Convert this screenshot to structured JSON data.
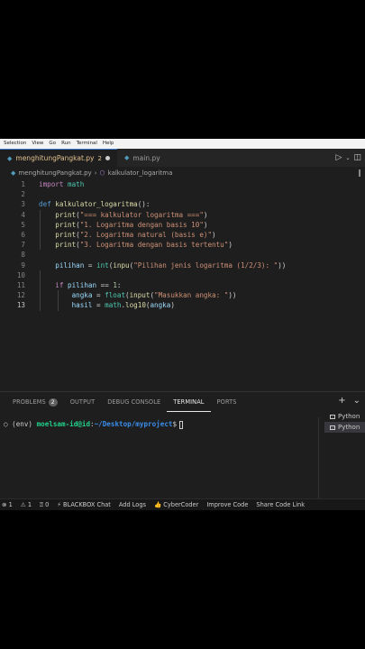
{
  "menubar": {
    "items": [
      "Selection",
      "View",
      "Go",
      "Run",
      "Terminal",
      "Help"
    ]
  },
  "tabs": [
    {
      "label": "menghitungPangkat.py",
      "badge": "2",
      "active": true
    },
    {
      "label": "main.py",
      "active": false
    }
  ],
  "tabbar_icons": {
    "run": "play-icon",
    "dropdown": "chevron-down-icon",
    "split": "split-editor-icon"
  },
  "breadcrumb": {
    "file": "menghitungPangkat.py",
    "separator": "›",
    "symbol": "kalkulator_logaritma"
  },
  "editor": {
    "lines": [
      {
        "n": "1",
        "tokens": [
          [
            "kw",
            "import"
          ],
          [
            "op",
            " "
          ],
          [
            "cls",
            "math"
          ]
        ]
      },
      {
        "n": "2",
        "tokens": []
      },
      {
        "n": "3",
        "tokens": [
          [
            "def",
            "def"
          ],
          [
            "op",
            " "
          ],
          [
            "fn",
            "kalkulator_logaritma"
          ],
          [
            "op",
            "():"
          ]
        ]
      },
      {
        "n": "4",
        "tokens": [
          [
            "op",
            "    "
          ],
          [
            "fn",
            "print"
          ],
          [
            "op",
            "("
          ],
          [
            "str",
            "\"=== kalkulator logaritma ===\""
          ],
          [
            "op",
            ")"
          ]
        ]
      },
      {
        "n": "5",
        "tokens": [
          [
            "op",
            "    "
          ],
          [
            "fn",
            "print"
          ],
          [
            "op",
            "("
          ],
          [
            "str",
            "\"1. Logaritma dengan basis 10\""
          ],
          [
            "op",
            ")"
          ]
        ]
      },
      {
        "n": "6",
        "tokens": [
          [
            "op",
            "    "
          ],
          [
            "fn",
            "print"
          ],
          [
            "op",
            "("
          ],
          [
            "str",
            "\"2. Logaritma natural (basis e)\""
          ],
          [
            "op",
            ")"
          ]
        ]
      },
      {
        "n": "7",
        "tokens": [
          [
            "op",
            "    "
          ],
          [
            "fn",
            "print"
          ],
          [
            "op",
            "("
          ],
          [
            "str",
            "\"3. Logaritma dengan basis tertentu\""
          ],
          [
            "op",
            ")"
          ]
        ]
      },
      {
        "n": "8",
        "tokens": []
      },
      {
        "n": "9",
        "tokens": [
          [
            "op",
            "    "
          ],
          [
            "var",
            "pilihan"
          ],
          [
            "op",
            " = "
          ],
          [
            "cls",
            "int"
          ],
          [
            "op",
            "("
          ],
          [
            "fn",
            "inpu"
          ],
          [
            "op",
            "("
          ],
          [
            "str",
            "\"Pilihan jenis logaritma (1/2/3): \""
          ],
          [
            "op",
            "))"
          ]
        ]
      },
      {
        "n": "10",
        "tokens": []
      },
      {
        "n": "11",
        "tokens": [
          [
            "op",
            "    "
          ],
          [
            "kw",
            "if"
          ],
          [
            "op",
            " "
          ],
          [
            "var",
            "pilihan"
          ],
          [
            "op",
            " == "
          ],
          [
            "num",
            "1"
          ],
          [
            "op",
            ":"
          ]
        ]
      },
      {
        "n": "12",
        "tokens": [
          [
            "op",
            "        "
          ],
          [
            "var",
            "angka"
          ],
          [
            "op",
            " = "
          ],
          [
            "cls",
            "float"
          ],
          [
            "op",
            "("
          ],
          [
            "fn",
            "input"
          ],
          [
            "op",
            "("
          ],
          [
            "str",
            "\"Masukkan angka: \""
          ],
          [
            "op",
            "))"
          ]
        ]
      },
      {
        "n": "13",
        "tokens": [
          [
            "op",
            "        "
          ],
          [
            "var",
            "hasil"
          ],
          [
            "op",
            " = "
          ],
          [
            "cls",
            "math"
          ],
          [
            "op",
            "."
          ],
          [
            "fn",
            "log10"
          ],
          [
            "op",
            "("
          ],
          [
            "var",
            "angka"
          ],
          [
            "op",
            ")"
          ]
        ],
        "current": true
      }
    ]
  },
  "panel": {
    "tabs": [
      {
        "label": "PROBLEMS",
        "badge": "2"
      },
      {
        "label": "OUTPUT"
      },
      {
        "label": "DEBUG CONSOLE"
      },
      {
        "label": "TERMINAL",
        "active": true
      },
      {
        "label": "PORTS"
      }
    ],
    "actions": [
      "+",
      "⌄"
    ],
    "terminal": {
      "prefix": "○ (env) ",
      "user": "moelsam-id@id",
      "colon": ":",
      "path": "~/Desktop/myproject",
      "prompt": "$"
    },
    "terminal_list": [
      "Python",
      "Python"
    ]
  },
  "statusbar": {
    "items": [
      {
        "icon": "error-icon",
        "text": "⊗ 1"
      },
      {
        "icon": "warning-icon",
        "text": "⚠ 1"
      },
      {
        "icon": "ports-icon",
        "text": "⍰ 0"
      },
      {
        "icon": "blackbox-icon",
        "text": "⚡ BLACKBOX Chat"
      },
      {
        "icon": "",
        "text": "Add Logs"
      },
      {
        "icon": "cybercoder-icon",
        "text": "👍 CyberCoder"
      },
      {
        "icon": "",
        "text": "Improve Code"
      },
      {
        "icon": "",
        "text": "Share Code Link"
      }
    ]
  }
}
